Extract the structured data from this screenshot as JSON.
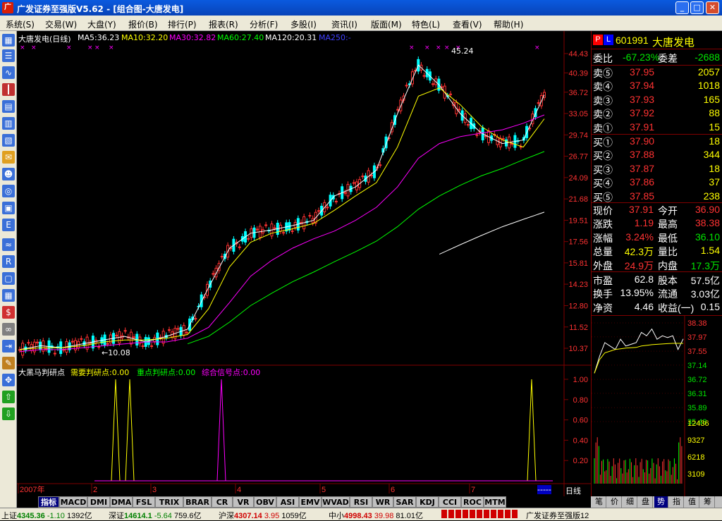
{
  "window": {
    "title": "广发证券至强版V5.62 - [组合图-大唐发电]",
    "icon": "app-logo-icon",
    "buttons": [
      "_",
      "□",
      "✕"
    ]
  },
  "menu": [
    "系统(S)",
    "交易(W)",
    "大盘(Y)",
    "报价(B)",
    "排行(P)",
    "报表(R)",
    "分析(F)",
    "多股(I)",
    "资讯(I)",
    "版面(M)",
    "特色(L)",
    "查看(V)",
    "帮助(H)"
  ],
  "chart": {
    "title": "大唐发电(日线)",
    "ma": [
      {
        "label": "MA5:36.23",
        "color": "#ffffff"
      },
      {
        "label": "MA10:32.20",
        "color": "#ffff00"
      },
      {
        "label": "MA30:32.82",
        "color": "#ff00ff"
      },
      {
        "label": "MA60:27.40",
        "color": "#00ff00"
      },
      {
        "label": "MA120:20.31",
        "color": "#ffffff"
      },
      {
        "label": "MA250:-",
        "color": "#4040ff"
      }
    ],
    "high_mark": "45.24",
    "low_mark": "←10.08",
    "price_axis": [
      "44.43",
      "40.39",
      "36.72",
      "33.05",
      "29.74",
      "26.77",
      "24.09",
      "21.68",
      "19.51",
      "17.56",
      "15.81",
      "14.23",
      "12.80",
      "11.52",
      "10.37"
    ],
    "indicator": {
      "name": "大黑马判研点",
      "items": [
        {
          "label": "需要判研点:0.00",
          "color": "#ffff00"
        },
        {
          "label": "重点判研点:0.00",
          "color": "#00ff00"
        },
        {
          "label": "综合信号点:0.00",
          "color": "#ff00ff"
        }
      ],
      "axis": [
        "1.00",
        "0.80",
        "0.60",
        "0.40",
        "0.20"
      ]
    },
    "time_axis": [
      "2007年",
      "2",
      "3",
      "4",
      "5",
      "6",
      "7"
    ],
    "period": "日线",
    "period_marker": "-----"
  },
  "chart_data": [
    {
      "type": "line",
      "title": "大唐发电(日线)",
      "ylim": [
        10.37,
        44.43
      ],
      "series": [
        {
          "name": "MA5",
          "values": [
            10.3,
            10.5,
            10.4,
            10.6,
            10.8,
            11.0,
            10.7,
            11.0,
            11.4,
            14.0,
            17.0,
            18.3,
            18.6,
            19.0,
            19.5,
            22.0,
            23.0,
            25.0,
            33.0,
            42.0,
            38.0,
            33.0,
            30.0,
            28.5,
            29.0,
            36.23
          ]
        },
        {
          "name": "MA10",
          "values": [
            10.3,
            10.4,
            10.4,
            10.5,
            10.7,
            10.8,
            10.8,
            10.9,
            11.1,
            12.6,
            15.5,
            17.5,
            18.3,
            18.7,
            19.2,
            20.5,
            22.0,
            23.5,
            28.0,
            36.0,
            37.5,
            34.5,
            31.0,
            29.0,
            28.0,
            32.2
          ]
        },
        {
          "name": "MA30",
          "values": [
            10.2,
            10.3,
            10.3,
            10.4,
            10.5,
            10.6,
            10.7,
            10.7,
            10.9,
            11.5,
            13.0,
            14.8,
            16.0,
            17.0,
            17.8,
            18.5,
            19.5,
            20.8,
            23.0,
            26.5,
            28.5,
            29.5,
            30.0,
            30.5,
            31.5,
            32.82
          ]
        },
        {
          "name": "MA60",
          "values": [
            null,
            null,
            null,
            null,
            null,
            null,
            null,
            null,
            10.6,
            11.0,
            11.8,
            12.8,
            13.6,
            14.4,
            15.1,
            15.9,
            16.7,
            17.6,
            18.9,
            20.6,
            22.0,
            23.2,
            24.3,
            25.2,
            26.3,
            27.4
          ]
        },
        {
          "name": "MA120",
          "values": [
            null,
            null,
            null,
            null,
            null,
            null,
            null,
            null,
            null,
            null,
            null,
            null,
            null,
            null,
            null,
            null,
            null,
            null,
            null,
            null,
            16.5,
            17.3,
            18.1,
            18.9,
            19.6,
            20.31
          ]
        }
      ],
      "annotations": [
        "45.24",
        "10.08"
      ]
    },
    {
      "type": "line",
      "title": "大黑马判研点",
      "ylim": [
        0,
        1.0
      ],
      "series": [
        {
          "name": "需要判研点",
          "values": [
            0,
            1,
            0,
            1,
            0,
            0,
            0,
            0,
            0,
            0,
            0,
            0,
            0,
            0,
            0,
            0,
            0,
            0,
            0,
            0,
            0,
            0,
            1,
            0
          ]
        },
        {
          "name": "综合信号点",
          "values": [
            0,
            0,
            0,
            0,
            0,
            0,
            1,
            0,
            0,
            0,
            0,
            0,
            0,
            0,
            0,
            0,
            0,
            0,
            0,
            0,
            0,
            0,
            0,
            0
          ]
        }
      ]
    },
    {
      "type": "line",
      "title": "",
      "ylim": [
        37.14,
        38.38
      ],
      "series": [
        {
          "name": "price",
          "values": [
            36.9,
            37.4,
            37.8,
            37.7,
            37.6,
            37.9,
            37.7,
            37.75,
            37.8,
            38.1,
            38.0,
            38.2,
            37.9,
            38.0,
            37.95,
            38.0,
            37.6,
            37.91
          ]
        },
        {
          "name": "avg",
          "values": [
            36.9,
            37.3,
            37.5,
            37.55,
            37.6,
            37.62,
            37.64,
            37.65,
            37.66,
            37.7,
            37.72,
            37.74,
            37.75,
            37.76,
            37.77,
            37.78,
            37.78,
            37.78
          ]
        }
      ]
    }
  ],
  "quote": {
    "code": "601991",
    "name": "大唐发电",
    "weibi_label": "委比",
    "weibi": "-67.23%",
    "weicha_label": "委差",
    "weicha": "-2688",
    "sell": [
      {
        "label": "卖⑤",
        "price": "37.95",
        "vol": "2057"
      },
      {
        "label": "卖④",
        "price": "37.94",
        "vol": "1018"
      },
      {
        "label": "卖③",
        "price": "37.93",
        "vol": "165"
      },
      {
        "label": "卖②",
        "price": "37.92",
        "vol": "88"
      },
      {
        "label": "卖①",
        "price": "37.91",
        "vol": "15"
      }
    ],
    "buy": [
      {
        "label": "买①",
        "price": "37.90",
        "vol": "18"
      },
      {
        "label": "买②",
        "price": "37.88",
        "vol": "344"
      },
      {
        "label": "买③",
        "price": "37.87",
        "vol": "18"
      },
      {
        "label": "买④",
        "price": "37.86",
        "vol": "37"
      },
      {
        "label": "买⑤",
        "price": "37.85",
        "vol": "238"
      }
    ],
    "stats": [
      {
        "l1": "现价",
        "v1": "37.91",
        "c1": "red",
        "l2": "今开",
        "v2": "36.90",
        "c2": "red"
      },
      {
        "l1": "涨跌",
        "v1": "1.19",
        "c1": "red",
        "l2": "最高",
        "v2": "38.38",
        "c2": "red"
      },
      {
        "l1": "涨幅",
        "v1": "3.24%",
        "c1": "red",
        "l2": "最低",
        "v2": "36.10",
        "c2": "grn"
      },
      {
        "l1": "总量",
        "v1": "42.3万",
        "c1": "yel",
        "l2": "量比",
        "v2": "1.54",
        "c2": "yel"
      },
      {
        "l1": "外盘",
        "v1": "24.9万",
        "c1": "red",
        "l2": "内盘",
        "v2": "17.3万",
        "c2": "grn"
      }
    ],
    "fin": [
      {
        "l1": "市盈",
        "v1": "62.8",
        "l2": "股本",
        "v2": "57.5亿"
      },
      {
        "l1": "换手",
        "v1": "13.95%",
        "l2": "流通",
        "v2": "3.03亿"
      },
      {
        "l1": "净资",
        "v1": "4.46",
        "l2": "收益(一)",
        "v2": "0.15"
      }
    ],
    "intraday_axis": [
      "38.38",
      "37.97",
      "37.55",
      "37.14",
      "36.72",
      "36.31",
      "35.89",
      "35.48"
    ],
    "vol_axis": [
      "12436",
      "9327",
      "6218",
      "3109"
    ]
  },
  "tabs": [
    "指标",
    "MACD",
    "DMI",
    "DMA",
    "FSL",
    "TRIX",
    "BRAR",
    "CR",
    "VR",
    "OBV",
    "ASI",
    "EMV",
    "WVAD",
    "RSI",
    "WR",
    "SAR",
    "KDJ",
    "CCI",
    "ROC",
    "MTM"
  ],
  "panel_tabs": [
    "笔",
    "价",
    "细",
    "盘",
    "势",
    "指",
    "值",
    "筹"
  ],
  "status": {
    "sh_label": "上证",
    "sh_val": "4345.36",
    "sh_chg": "-1.10",
    "sh_amt": "1392亿",
    "sz_label": "深证",
    "sz_val": "14614.1",
    "sz_chg": "-5.64",
    "sz_amt": "759.6亿",
    "hs_label": "沪深",
    "hs_val": "4307.14",
    "hs_chg": "3.95",
    "hs_amt": "1059亿",
    "zx_label": "中小",
    "zx_val": "4998.43",
    "zx_chg": "39.98",
    "zx_amt": "81.01亿",
    "app": "广发证券至强版12"
  },
  "colors": {
    "up": "#ff3232",
    "down": "#00ffff",
    "frame": "#800000",
    "title_bar": "#0a5adf"
  }
}
